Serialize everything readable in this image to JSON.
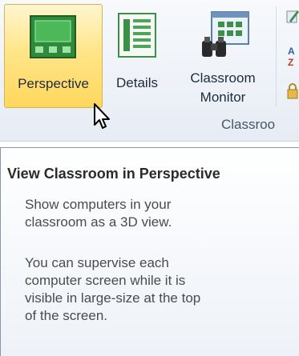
{
  "ribbon": {
    "buttons": [
      {
        "label": "Perspective",
        "icon": "perspective-icon",
        "active": true
      },
      {
        "label": "Details",
        "icon": "details-icon"
      },
      {
        "label_line1": "Classroom",
        "label_line2": "Monitor",
        "icon": "binoculars-icon"
      }
    ],
    "group_label": "Classroo"
  },
  "tooltip": {
    "title": "View Classroom in Perspective",
    "paragraph1_line1": "Show computers in your",
    "paragraph1_line2": "classroom as a 3D view.",
    "paragraph2_line1": "You can supervise each",
    "paragraph2_line2": "computer screen while it is",
    "paragraph2_line3": "visible in large-size at the top",
    "paragraph2_line4": "of the screen."
  },
  "colors": {
    "active_bg": "#ffe58a",
    "ribbon_bg": "#eef2f8",
    "tooltip_border": "#8a96a8"
  }
}
